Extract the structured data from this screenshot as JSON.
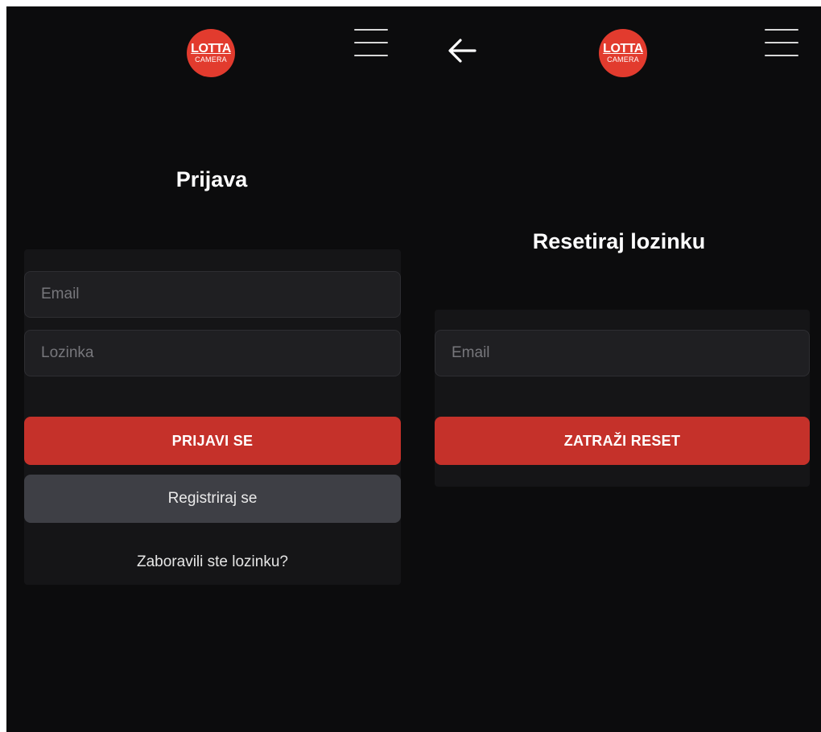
{
  "brand": {
    "logo_line1": "LOTTA",
    "logo_line2": "CAMERA",
    "accent": "#e23b2e"
  },
  "login": {
    "title": "Prijava",
    "email_placeholder": "Email",
    "password_placeholder": "Lozinka",
    "submit_label": "PRIJAVI SE",
    "register_label": "Registriraj se",
    "forgot_label": "Zaboravili ste lozinku?"
  },
  "reset": {
    "title": "Resetiraj lozinku",
    "email_placeholder": "Email",
    "submit_label": "ZATRAŽI RESET"
  },
  "icons": {
    "menu": "hamburger-menu-icon",
    "back": "arrow-left-icon"
  },
  "colors": {
    "background": "#0c0c0d",
    "card": "#151517",
    "primary_button": "#c5312a",
    "secondary_button": "#3e3f45"
  }
}
